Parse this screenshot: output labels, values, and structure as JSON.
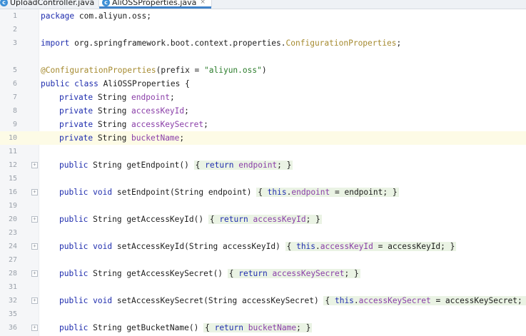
{
  "tabs": [
    {
      "label": "UploadController.java",
      "close": "×",
      "active": false
    },
    {
      "label": "AliOSSProperties.java",
      "close": "×",
      "active": true
    }
  ],
  "icons": {
    "class_file": "java-class-icon"
  },
  "lines": [
    {
      "num": "1"
    },
    {
      "num": "2"
    },
    {
      "num": "3"
    },
    {
      "num": "5"
    },
    {
      "num": "6"
    },
    {
      "num": "7"
    },
    {
      "num": "8"
    },
    {
      "num": "9"
    },
    {
      "num": "10"
    },
    {
      "num": "11"
    },
    {
      "num": "12"
    },
    {
      "num": "15"
    },
    {
      "num": "16"
    },
    {
      "num": "19"
    },
    {
      "num": "20"
    },
    {
      "num": "23"
    },
    {
      "num": "24"
    },
    {
      "num": "27"
    },
    {
      "num": "28"
    },
    {
      "num": "31"
    },
    {
      "num": "32"
    },
    {
      "num": "35"
    },
    {
      "num": "36"
    }
  ],
  "code": {
    "l1": [
      "package",
      " com.aliyun.oss;"
    ],
    "l3": [
      "import",
      " org.springframework.boot.context.properties.",
      "ConfigurationProperties",
      ";"
    ],
    "l5": [
      "@ConfigurationProperties",
      "(prefix = ",
      "\"aliyun.oss\"",
      ")"
    ],
    "l6": [
      "public class",
      " AliOSSProperties {"
    ],
    "l7": [
      "private",
      " String ",
      "endpoint",
      ";"
    ],
    "l8": [
      "private",
      " String ",
      "accessKeyId",
      ";"
    ],
    "l9": [
      "private",
      " String ",
      "accessKeySecret",
      ";"
    ],
    "l10": [
      "private",
      " String ",
      "bucketName",
      ";"
    ],
    "l12": [
      "public",
      " String ",
      "getEndpoint",
      "() ",
      "{ ",
      "return",
      " ",
      "endpoint",
      "; }"
    ],
    "l16": [
      "public void",
      " ",
      "setEndpoint",
      "(String endpoint) ",
      "{ ",
      "this",
      ".",
      "endpoint",
      " = endpoint; }"
    ],
    "l20": [
      "public",
      " String ",
      "getAccessKeyId",
      "() ",
      "{ ",
      "return",
      " ",
      "accessKeyId",
      "; }"
    ],
    "l24": [
      "public void",
      " ",
      "setAccessKeyId",
      "(String accessKeyId) ",
      "{ ",
      "this",
      ".",
      "accessKeyId",
      " = accessKeyId; }"
    ],
    "l28": [
      "public",
      " String ",
      "getAccessKeySecret",
      "() ",
      "{ ",
      "return",
      " ",
      "accessKeySecret",
      "; }"
    ],
    "l32": [
      "public void",
      " ",
      "setAccessKeySecret",
      "(String accessKeySecret) ",
      "{ ",
      "this",
      ".",
      "accessKeySecret",
      " = accessKeySecret; "
    ],
    "l36": [
      "public",
      " String ",
      "getBucketName",
      "() ",
      "{ ",
      "return",
      " ",
      "bucketName",
      "; }"
    ]
  }
}
